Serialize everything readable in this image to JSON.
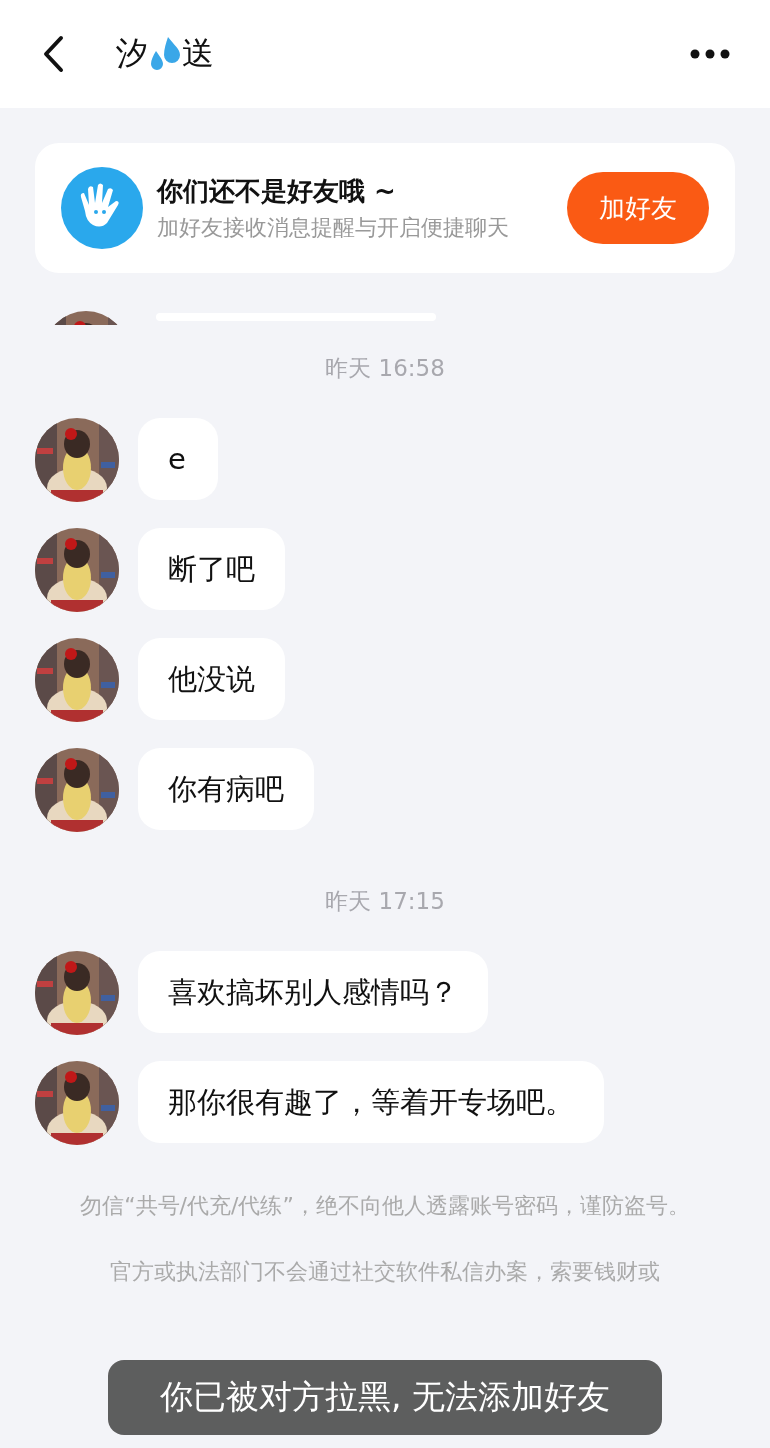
{
  "header": {
    "title_start": "汐",
    "title_end": "送"
  },
  "friend_banner": {
    "title": "你们还不是好友哦 ~",
    "subtitle": "加好友接收消息提醒与开启便捷聊天",
    "button": "加好友"
  },
  "messages": [
    {
      "kind": "time",
      "text": "昨天 16:58"
    },
    {
      "kind": "message",
      "text": "e"
    },
    {
      "kind": "message",
      "text": "断了吧"
    },
    {
      "kind": "message",
      "text": "他没说"
    },
    {
      "kind": "message",
      "text": "你有病吧"
    },
    {
      "kind": "time",
      "text": "昨天 17:15"
    },
    {
      "kind": "message",
      "text": "喜欢搞坏别人感情吗？"
    },
    {
      "kind": "message",
      "text": "那你很有趣了，等着开专场吧。"
    }
  ],
  "notices": [
    "勿信“共号/代充/代练”，绝不向他人透露账号密码，谨防盗号。",
    "官方或执法部门不会通过社交软件私信办案，索要钱财或"
  ],
  "toast": "你已被对方拉黑, 无法添加好友"
}
